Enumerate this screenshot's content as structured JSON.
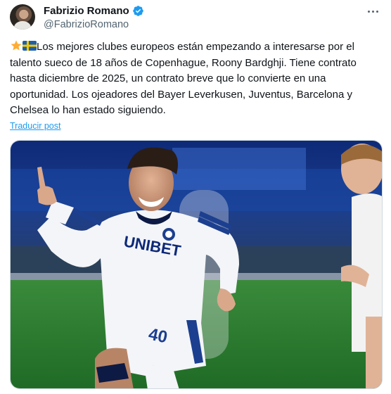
{
  "author": {
    "display_name": "Fabrizio Romano",
    "handle": "@FabrizioRomano",
    "verified": true,
    "verified_color": "#1d9bf0"
  },
  "post": {
    "text": "Los mejores clubes europeos están empezando a interesarse por el talento sueco de 18 años de Copenhague, Roony Bardghji. Tiene contrato hasta diciembre de 2025, un contrato breve que lo convierte en una oportunidad. Los ojeadores del Bayer Leverkusen, Juventus, Barcelona y Chelsea lo han estado siguiendo.",
    "emojis": [
      "star-emoji",
      "sweden-flag-emoji"
    ],
    "translate_label": "Traducir post"
  },
  "media": {
    "kit_text": "UNIBET",
    "shirt_number": "40"
  },
  "colors": {
    "link": "#1d9bf0",
    "secondary_text": "#536471",
    "primary_text": "#0f1419"
  }
}
